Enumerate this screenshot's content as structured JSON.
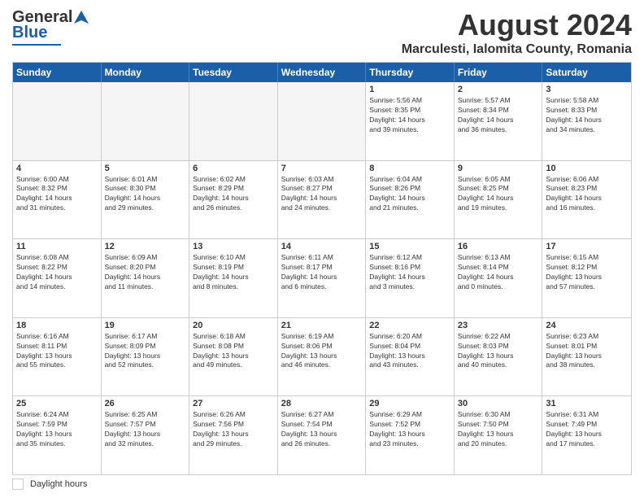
{
  "header": {
    "logo_general": "General",
    "logo_blue": "Blue",
    "main_title": "August 2024",
    "subtitle": "Marculesti, Ialomita County, Romania"
  },
  "day_headers": [
    "Sunday",
    "Monday",
    "Tuesday",
    "Wednesday",
    "Thursday",
    "Friday",
    "Saturday"
  ],
  "footer": {
    "label": "Daylight hours"
  },
  "weeks": [
    [
      {
        "day": "",
        "info": ""
      },
      {
        "day": "",
        "info": ""
      },
      {
        "day": "",
        "info": ""
      },
      {
        "day": "",
        "info": ""
      },
      {
        "day": "1",
        "info": "Sunrise: 5:56 AM\nSunset: 8:35 PM\nDaylight: 14 hours\nand 39 minutes."
      },
      {
        "day": "2",
        "info": "Sunrise: 5:57 AM\nSunset: 8:34 PM\nDaylight: 14 hours\nand 36 minutes."
      },
      {
        "day": "3",
        "info": "Sunrise: 5:58 AM\nSunset: 8:33 PM\nDaylight: 14 hours\nand 34 minutes."
      }
    ],
    [
      {
        "day": "4",
        "info": "Sunrise: 6:00 AM\nSunset: 8:32 PM\nDaylight: 14 hours\nand 31 minutes."
      },
      {
        "day": "5",
        "info": "Sunrise: 6:01 AM\nSunset: 8:30 PM\nDaylight: 14 hours\nand 29 minutes."
      },
      {
        "day": "6",
        "info": "Sunrise: 6:02 AM\nSunset: 8:29 PM\nDaylight: 14 hours\nand 26 minutes."
      },
      {
        "day": "7",
        "info": "Sunrise: 6:03 AM\nSunset: 8:27 PM\nDaylight: 14 hours\nand 24 minutes."
      },
      {
        "day": "8",
        "info": "Sunrise: 6:04 AM\nSunset: 8:26 PM\nDaylight: 14 hours\nand 21 minutes."
      },
      {
        "day": "9",
        "info": "Sunrise: 6:05 AM\nSunset: 8:25 PM\nDaylight: 14 hours\nand 19 minutes."
      },
      {
        "day": "10",
        "info": "Sunrise: 6:06 AM\nSunset: 8:23 PM\nDaylight: 14 hours\nand 16 minutes."
      }
    ],
    [
      {
        "day": "11",
        "info": "Sunrise: 6:08 AM\nSunset: 8:22 PM\nDaylight: 14 hours\nand 14 minutes."
      },
      {
        "day": "12",
        "info": "Sunrise: 6:09 AM\nSunset: 8:20 PM\nDaylight: 14 hours\nand 11 minutes."
      },
      {
        "day": "13",
        "info": "Sunrise: 6:10 AM\nSunset: 8:19 PM\nDaylight: 14 hours\nand 8 minutes."
      },
      {
        "day": "14",
        "info": "Sunrise: 6:11 AM\nSunset: 8:17 PM\nDaylight: 14 hours\nand 6 minutes."
      },
      {
        "day": "15",
        "info": "Sunrise: 6:12 AM\nSunset: 8:16 PM\nDaylight: 14 hours\nand 3 minutes."
      },
      {
        "day": "16",
        "info": "Sunrise: 6:13 AM\nSunset: 8:14 PM\nDaylight: 14 hours\nand 0 minutes."
      },
      {
        "day": "17",
        "info": "Sunrise: 6:15 AM\nSunset: 8:12 PM\nDaylight: 13 hours\nand 57 minutes."
      }
    ],
    [
      {
        "day": "18",
        "info": "Sunrise: 6:16 AM\nSunset: 8:11 PM\nDaylight: 13 hours\nand 55 minutes."
      },
      {
        "day": "19",
        "info": "Sunrise: 6:17 AM\nSunset: 8:09 PM\nDaylight: 13 hours\nand 52 minutes."
      },
      {
        "day": "20",
        "info": "Sunrise: 6:18 AM\nSunset: 8:08 PM\nDaylight: 13 hours\nand 49 minutes."
      },
      {
        "day": "21",
        "info": "Sunrise: 6:19 AM\nSunset: 8:06 PM\nDaylight: 13 hours\nand 46 minutes."
      },
      {
        "day": "22",
        "info": "Sunrise: 6:20 AM\nSunset: 8:04 PM\nDaylight: 13 hours\nand 43 minutes."
      },
      {
        "day": "23",
        "info": "Sunrise: 6:22 AM\nSunset: 8:03 PM\nDaylight: 13 hours\nand 40 minutes."
      },
      {
        "day": "24",
        "info": "Sunrise: 6:23 AM\nSunset: 8:01 PM\nDaylight: 13 hours\nand 38 minutes."
      }
    ],
    [
      {
        "day": "25",
        "info": "Sunrise: 6:24 AM\nSunset: 7:59 PM\nDaylight: 13 hours\nand 35 minutes."
      },
      {
        "day": "26",
        "info": "Sunrise: 6:25 AM\nSunset: 7:57 PM\nDaylight: 13 hours\nand 32 minutes."
      },
      {
        "day": "27",
        "info": "Sunrise: 6:26 AM\nSunset: 7:56 PM\nDaylight: 13 hours\nand 29 minutes."
      },
      {
        "day": "28",
        "info": "Sunrise: 6:27 AM\nSunset: 7:54 PM\nDaylight: 13 hours\nand 26 minutes."
      },
      {
        "day": "29",
        "info": "Sunrise: 6:29 AM\nSunset: 7:52 PM\nDaylight: 13 hours\nand 23 minutes."
      },
      {
        "day": "30",
        "info": "Sunrise: 6:30 AM\nSunset: 7:50 PM\nDaylight: 13 hours\nand 20 minutes."
      },
      {
        "day": "31",
        "info": "Sunrise: 6:31 AM\nSunset: 7:49 PM\nDaylight: 13 hours\nand 17 minutes."
      }
    ]
  ]
}
